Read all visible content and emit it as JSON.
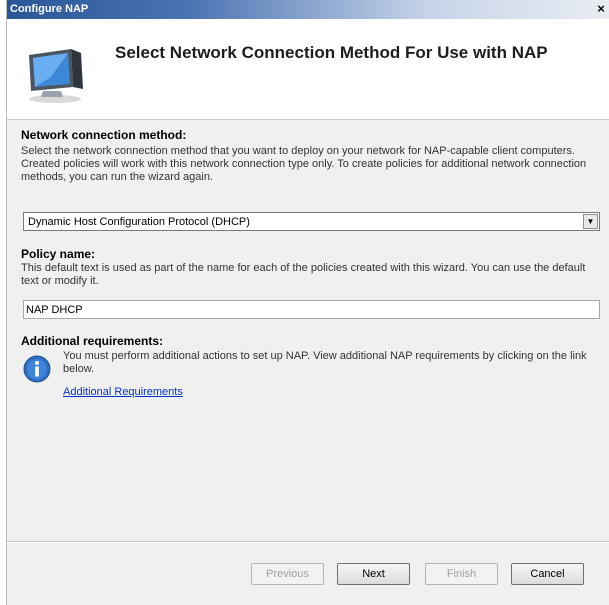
{
  "window": {
    "title": "Configure NAP",
    "close_glyph": "×"
  },
  "header": {
    "heading": "Select Network Connection Method For Use with NAP",
    "icon": "computer-monitor-icon"
  },
  "connection": {
    "label": "Network connection method:",
    "description": "Select the network connection method that you want to deploy on your network for NAP-capable client computers. Created policies will work with this network connection type only. To create policies for additional network connection methods, you can run the wizard again.",
    "selected": "Dynamic Host Configuration Protocol (DHCP)"
  },
  "policy": {
    "label": "Policy name:",
    "description": "This default text is used as part of the name for each of the policies created with this wizard. You can use the default text or modify it.",
    "value": "NAP DHCP"
  },
  "requirements": {
    "label": "Additional requirements:",
    "text": "You must perform additional actions to set up NAP. View additional NAP requirements by clicking on the link below.",
    "link": "Additional Requirements",
    "icon": "info-icon"
  },
  "buttons": {
    "previous": "Previous",
    "next": "Next",
    "finish": "Finish",
    "cancel": "Cancel"
  }
}
